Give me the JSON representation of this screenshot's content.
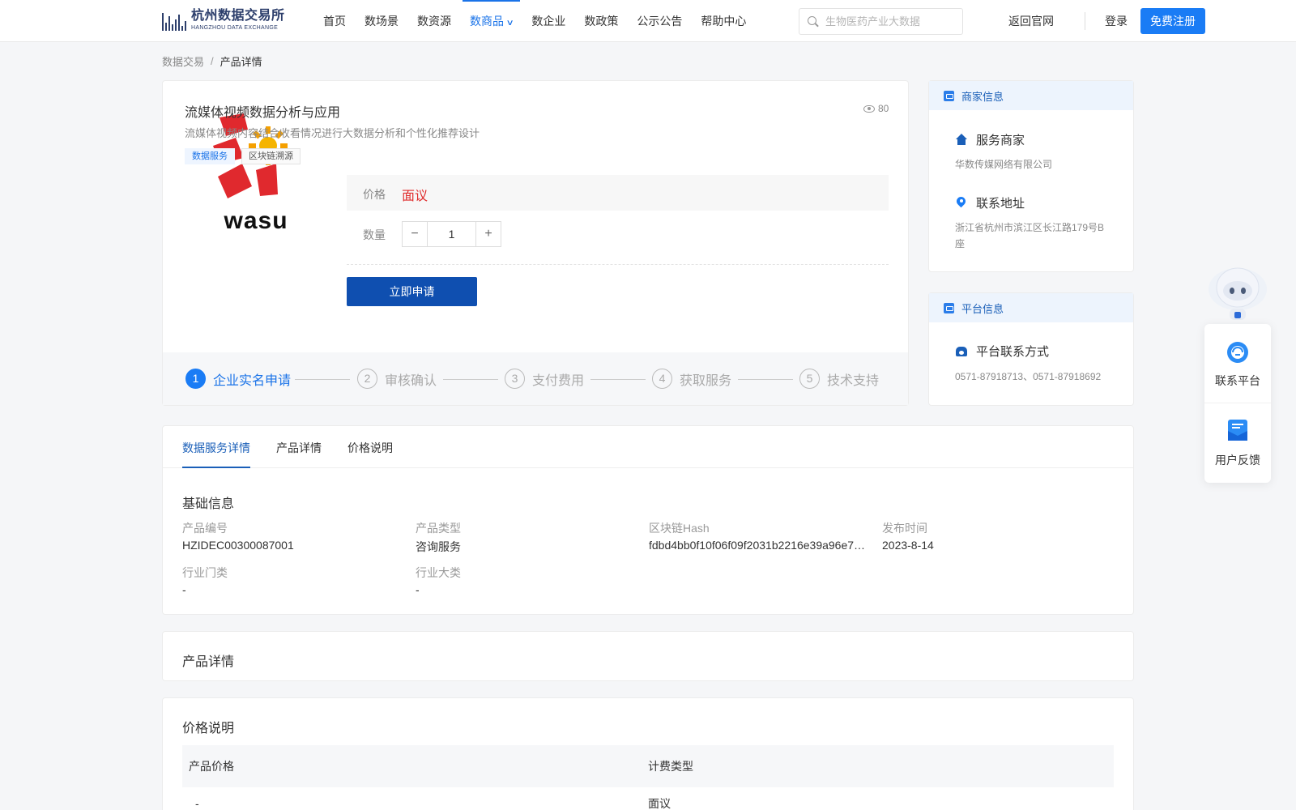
{
  "logo": {
    "cn": "杭州数据交易所",
    "en": "HANGZHOU DATA EXCHANGE"
  },
  "nav": [
    {
      "label": "首页"
    },
    {
      "label": "数场景"
    },
    {
      "label": "数资源"
    },
    {
      "label": "数商品",
      "active": true
    },
    {
      "label": "数企业"
    },
    {
      "label": "数政策"
    },
    {
      "label": "公示公告"
    },
    {
      "label": "帮助中心"
    }
  ],
  "search": {
    "placeholder": "生物医药产业大数据",
    "value": ""
  },
  "header": {
    "back_label": "返回官网",
    "login_label": "登录",
    "register_label": "免费注册"
  },
  "breadcrumb": {
    "parent": "数据交易",
    "sep": "/",
    "current": "产品详情"
  },
  "product": {
    "title": "流媒体视频数据分析与应用",
    "views": "80",
    "description": "流媒体视频内容结合收看情况进行大数据分析和个性化推荐设计",
    "tags": [
      "数据服务",
      "区块链溯源"
    ],
    "price_label": "价格",
    "price_value": "面议",
    "qty_label": "数量",
    "qty_value": "1",
    "apply_label": "立即申请",
    "logo_text": "wasu"
  },
  "steps": [
    {
      "num": "1",
      "label": "企业实名申请",
      "active": true
    },
    {
      "num": "2",
      "label": "审核确认"
    },
    {
      "num": "3",
      "label": "支付费用"
    },
    {
      "num": "4",
      "label": "获取服务"
    },
    {
      "num": "5",
      "label": "技术支持"
    }
  ],
  "merchant": {
    "head": "商家信息",
    "service_label": "服务商家",
    "service_value": "华数传媒网络有限公司",
    "address_label": "联系地址",
    "address_value": "浙江省杭州市滨江区长江路179号B座"
  },
  "platform": {
    "head": "平台信息",
    "contact_label": "平台联系方式",
    "contact_value": "0571-87918713、0571-87918692"
  },
  "float": {
    "contact_label": "联系平台",
    "feedback_label": "用户反馈"
  },
  "tabs": [
    {
      "label": "数据服务详情",
      "active": true
    },
    {
      "label": "产品详情"
    },
    {
      "label": "价格说明"
    }
  ],
  "basic_info": {
    "title": "基础信息",
    "fields": [
      {
        "key": "产品编号",
        "value": "HZIDEC00300087001"
      },
      {
        "key": "产品类型",
        "value": "咨询服务"
      },
      {
        "key": "区块链Hash",
        "value": "fdbd4bb0f10f06f09f2031b2216e39a96e7a…"
      },
      {
        "key": "发布时间",
        "value": "2023-8-14"
      },
      {
        "key": "行业门类",
        "value": "-"
      },
      {
        "key": "行业大类",
        "value": "-"
      }
    ]
  },
  "product_detail": {
    "title": "产品详情"
  },
  "price_info": {
    "title": "价格说明",
    "headers": [
      "产品价格",
      "计费类型"
    ],
    "rows": [
      [
        "-",
        "面议"
      ]
    ]
  }
}
